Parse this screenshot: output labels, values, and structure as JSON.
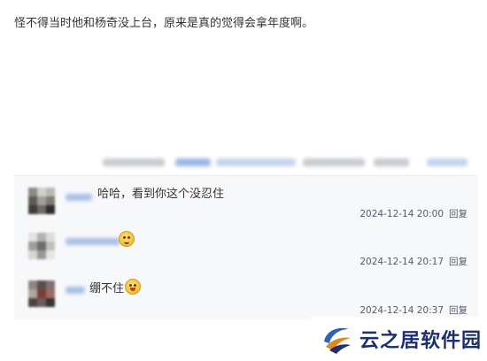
{
  "post": {
    "text": "怪不得当时他和杨奇没上台，原来是真的觉得会拿年度啊。"
  },
  "comments": [
    {
      "text": "哈哈，看到你这个没忍住",
      "timestamp": "2024-12-14 20:00",
      "reply_label": "回复",
      "emoji": ""
    },
    {
      "text": "",
      "timestamp": "2024-12-14 20:17",
      "reply_label": "回复",
      "emoji": "smile-emoji"
    },
    {
      "text": "绷不住",
      "timestamp": "2024-12-14 20:37",
      "reply_label": "回复",
      "emoji": "laugh-emoji"
    }
  ],
  "watermark": {
    "text": "云之居软件园"
  },
  "colors": {
    "comment_bg": "#f7f8fa",
    "blurred_link": "#9db7e4",
    "watermark_text": "#1b2f73"
  }
}
